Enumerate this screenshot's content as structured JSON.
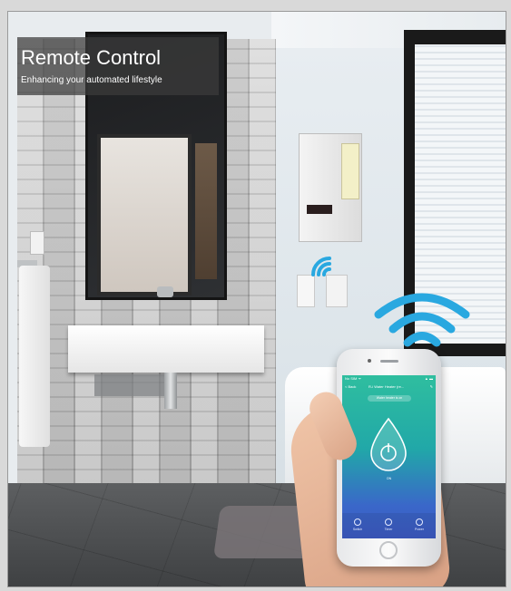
{
  "banner": {
    "title": "Remote Control",
    "subtitle": "Enhancing your automated lifestyle"
  },
  "phone_app": {
    "status_carrier": "No SIM ᯤ",
    "status_right": "▲ ▬",
    "back_label": "< Back",
    "header_title": "R-i Water Heater (re...",
    "edit_icon": "edit-icon",
    "device_label": "Water heater is on",
    "power_icon": "power-drop-icon",
    "power_state": "ON",
    "tabs": [
      {
        "label": "Switch",
        "icon": "switch-icon"
      },
      {
        "label": "Timer",
        "icon": "timer-icon"
      },
      {
        "label": "Power",
        "icon": "power-icon"
      }
    ]
  },
  "colors": {
    "wifi_blue": "#29a8e0",
    "screen_gradient_top": "#2fbe9f",
    "screen_gradient_bottom": "#3d5bc4"
  }
}
